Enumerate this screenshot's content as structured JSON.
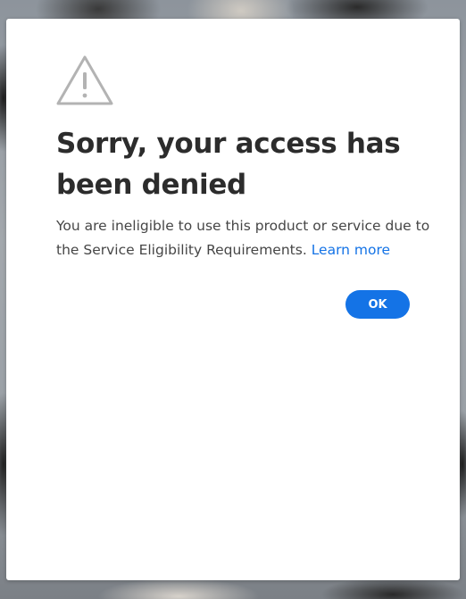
{
  "dialog": {
    "icon": "alert-triangle-icon",
    "title": "Sorry, your access has been denied",
    "message": "You are ineligible to use this product or service due to the Service Eligibility Requirements.",
    "learn_more_label": "Learn more",
    "ok_label": "OK"
  },
  "colors": {
    "accent": "#1473e6",
    "title_text": "#2c2c2c",
    "body_text": "#464646",
    "icon_stroke": "#b3b3b3",
    "dialog_bg": "#ffffff"
  }
}
